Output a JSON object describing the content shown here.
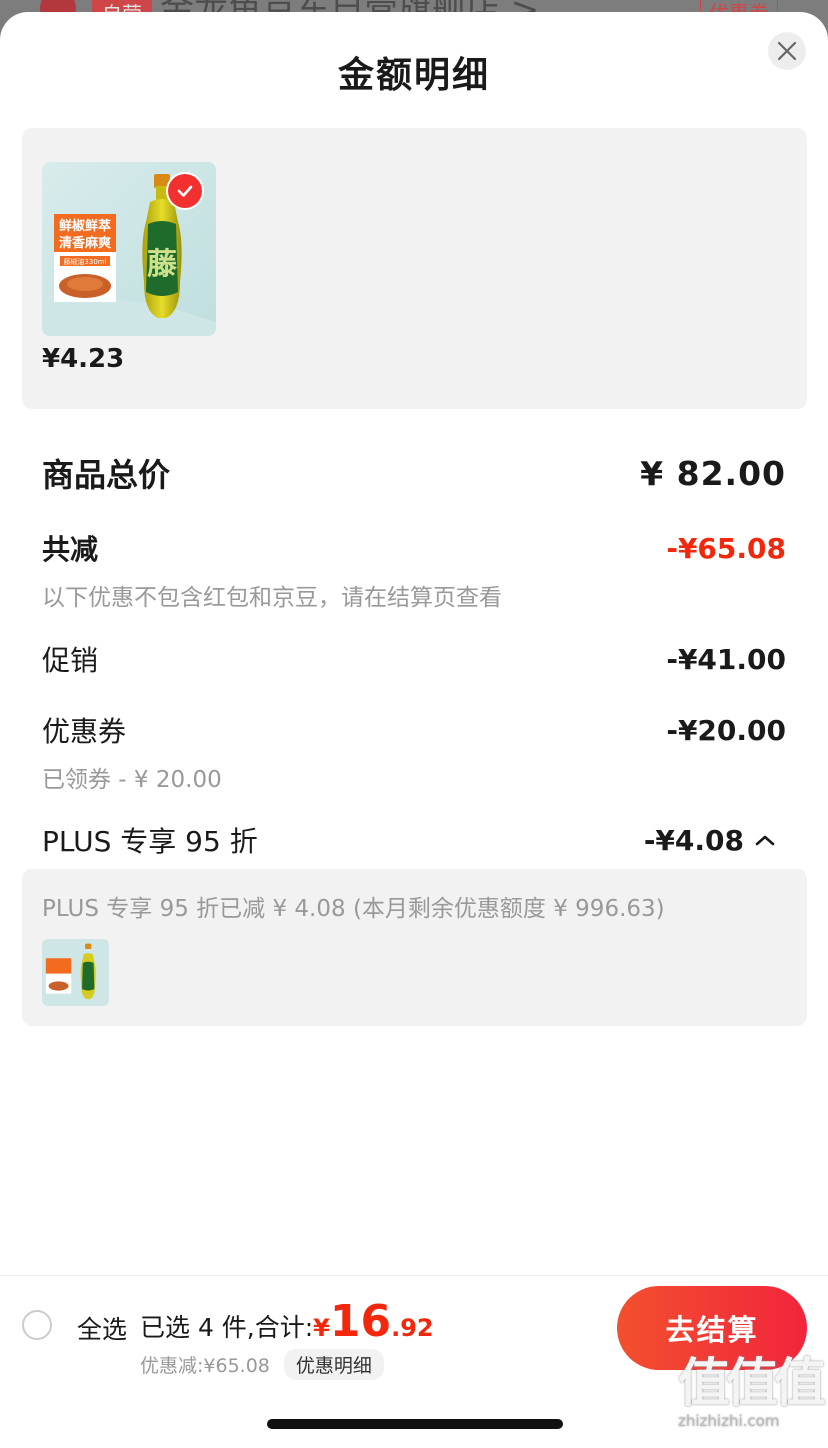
{
  "background": {
    "badge": "自营",
    "store_name": "金龙鱼京东自营旗舰店 >",
    "coupon": "优惠券"
  },
  "sheet": {
    "title": "金额明细"
  },
  "product": {
    "image_banner_line1": "鲜椒鲜萃",
    "image_banner_line2": "清香麻爽",
    "image_banner_sub": "藤椒油330ml",
    "image_bottle_char": "藤",
    "price": "¥4.23"
  },
  "summary": {
    "total_label": "商品总价",
    "total_value": "¥ 82.00",
    "reduce_label": "共减",
    "reduce_value": "-¥65.08",
    "note": "以下优惠不包含红包和京豆，请在结算页查看",
    "promo_label": "促销",
    "promo_value": "-¥41.00",
    "coupon_label": "优惠券",
    "coupon_value": "-¥20.00",
    "coupon_sub": "已领券 - ¥ 20.00",
    "plus_label": "PLUS 专享 95 折",
    "plus_value": "-¥4.08"
  },
  "plus_card": {
    "text": "PLUS 专享 95 折已减 ¥ 4.08 (本月剩余优惠额度 ¥ 996.63)"
  },
  "bottom_bar": {
    "select_all": "全选",
    "selected_text": "已选 4 件,合计:",
    "sum_yen": "¥",
    "sum_int": "16",
    "sum_dec": ".92",
    "discount_text": "优惠减:¥65.08",
    "detail_link": "优惠明细",
    "checkout": "去结算"
  },
  "watermark": {
    "mark": "值值值",
    "url": "zhizhizhi.com"
  },
  "colors": {
    "accent_red": "#f2270c",
    "checkout_gradient": [
      "#f2502e",
      "#f2243c"
    ],
    "card_bg": "#f2f2f2"
  }
}
